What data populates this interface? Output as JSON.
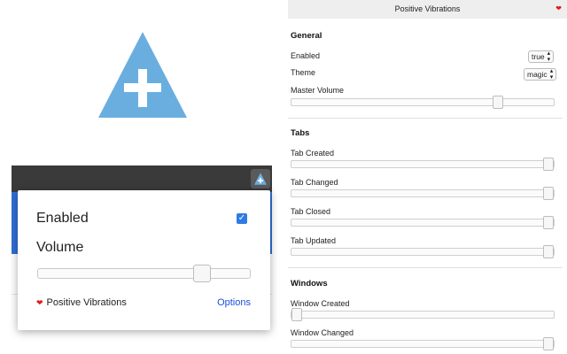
{
  "popup": {
    "enabled_label": "Enabled",
    "enabled_checked": true,
    "volume_label": "Volume",
    "volume_level": 0.8,
    "footer_name": "Positive Vibrations",
    "options_link": "Options"
  },
  "options_page": {
    "title": "Positive Vibrations",
    "sections": {
      "general": {
        "title": "General",
        "enabled": {
          "label": "Enabled",
          "value": "true"
        },
        "theme": {
          "label": "Theme",
          "value": "magic"
        },
        "master_volume": {
          "label": "Master Volume",
          "level": 0.8
        }
      },
      "tabs": {
        "title": "Tabs",
        "items": [
          {
            "label": "Tab Created",
            "level": 1.0
          },
          {
            "label": "Tab Changed",
            "level": 1.0
          },
          {
            "label": "Tab Closed",
            "level": 1.0
          },
          {
            "label": "Tab Updated",
            "level": 1.0
          }
        ]
      },
      "windows": {
        "title": "Windows",
        "items": [
          {
            "label": "Window Created",
            "level": 0.0
          },
          {
            "label": "Window Changed",
            "level": 1.0
          }
        ]
      }
    }
  },
  "colors": {
    "logo_blue": "#6aaee0",
    "accent_blue": "#2f6fd6",
    "heart_red": "#e11b1b",
    "link_blue": "#1a4fd6"
  },
  "icons": {
    "logo": "triangle-plus-icon",
    "extension": "triangle-plus-icon",
    "heart": "heart-icon"
  }
}
